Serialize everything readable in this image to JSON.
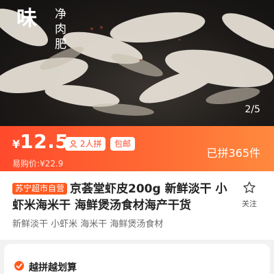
{
  "hero": {
    "overlay_big": "味",
    "overlay_vertical": "净肉肥",
    "pager": "2/5"
  },
  "price": {
    "currency": "¥",
    "value": "12.5",
    "group_pill": "2人拼",
    "mail_pill": "包邮",
    "grouped_count": "已拼365件",
    "easy_buy": "易购价:¥22.9"
  },
  "product": {
    "tag": "苏宁超市自营",
    "title": "京荟堂虾皮200g 新鲜淡干 小虾米海米干 海鲜煲汤食材海产干货",
    "subtitle": "新鲜淡干 小虾米 海米干 海鲜煲汤食材",
    "favorite_label": "关注"
  },
  "deal": {
    "title": "越拼越划算"
  },
  "colors": {
    "accent": "#ff4a2c",
    "gradient_end": "#ff8a3e",
    "tag_bg": "#ff5a1f"
  }
}
